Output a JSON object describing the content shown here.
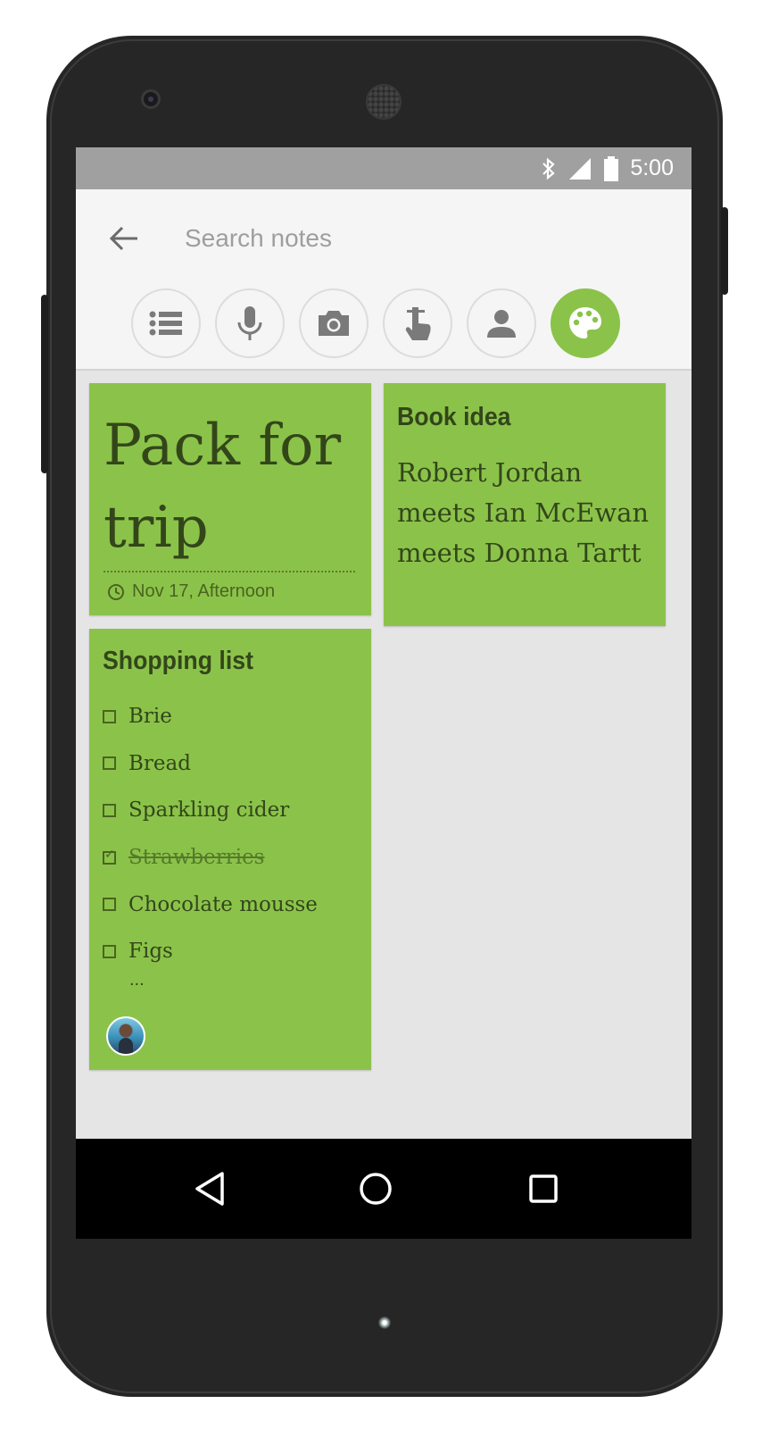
{
  "status_bar": {
    "time": "5:00"
  },
  "search": {
    "placeholder": "Search notes"
  },
  "toolbar": {
    "items": [
      "list-icon",
      "microphone-icon",
      "camera-icon",
      "drawing-icon",
      "contact-icon",
      "palette-icon"
    ],
    "active": "palette-icon",
    "accent_color": "#8bc34a"
  },
  "notes": {
    "trip": {
      "title": "Pack for trip",
      "reminder": "Nov 17, Afternoon"
    },
    "book": {
      "title": "Book idea",
      "body": "Robert Jordan meets Ian McEwan meets Donna Tartt"
    },
    "shopping": {
      "title": "Shopping list",
      "items": [
        {
          "text": "Brie",
          "checked": false
        },
        {
          "text": "Bread",
          "checked": false
        },
        {
          "text": "Sparkling cider",
          "checked": false
        },
        {
          "text": "Strawberries",
          "checked": true
        },
        {
          "text": "Chocolate mousse",
          "checked": false
        },
        {
          "text": "Figs",
          "checked": false
        }
      ],
      "more": "..."
    }
  },
  "note_color": "#8bc34a"
}
